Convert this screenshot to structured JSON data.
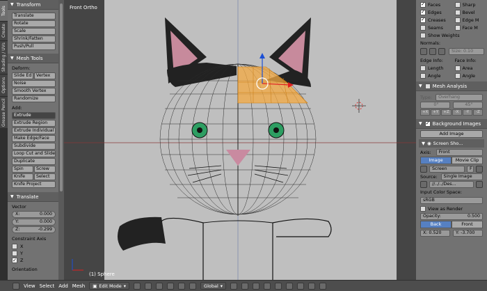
{
  "vtabs": [
    "Tools",
    "Create",
    "Shading / UVs",
    "Options",
    "Grease Pencil"
  ],
  "transform_panel": {
    "title": "Transform",
    "buttons": [
      "Translate",
      "Rotate",
      "Scale",
      "Shrink/Fatten",
      "Push/Pull"
    ]
  },
  "mesh_tools": {
    "title": "Mesh Tools",
    "deform_label": "Deform:",
    "deform_row": [
      "Slide Ed",
      "Vertex"
    ],
    "deform_buttons": [
      "Noise",
      "Smooth Vertex",
      "Randomize"
    ],
    "add_label": "Add:",
    "add_buttons": [
      "Extrude",
      "Extrude Region",
      "Extrude Individual",
      "Make Edge/Face",
      "Subdivide",
      "Loop Cut and Slide",
      "Duplicate"
    ],
    "rows": [
      [
        "Spin",
        "Screw"
      ],
      [
        "Knife",
        "Select"
      ]
    ],
    "knife_project": "Knife Project"
  },
  "translate_panel": {
    "title": "Translate",
    "vector_label": "Vector",
    "x": "X:",
    "x_val": "0.000",
    "y": "Y:",
    "y_val": "0.000",
    "z": "Z:",
    "z_val": "-0.299",
    "constraint_label": "Constraint Axis",
    "axes": [
      "X",
      "Y",
      "Z"
    ],
    "orientation_label": "Orientation"
  },
  "viewport": {
    "title": "Front Ortho",
    "object": "(1) Sphere"
  },
  "props": {
    "overlay": [
      {
        "label": "Faces",
        "on": true,
        "label2": "Sharp",
        "on2": false
      },
      {
        "label": "Edges",
        "on": true,
        "label2": "Bevel",
        "on2": false
      },
      {
        "label": "Creases",
        "on": true,
        "label2": "Edge M",
        "on2": false
      },
      {
        "label": "Seams",
        "on": false,
        "label2": "Face M",
        "on2": false
      }
    ],
    "show_weights": "Show Weights",
    "normals_label": "Normals:",
    "size_label": "Size: 0.10",
    "edge_info": "Edge Info:",
    "face_info": "Face Info:",
    "info_rows": [
      [
        "Length",
        "Area"
      ],
      [
        "Angle",
        "Angle"
      ]
    ],
    "mesh_analysis": "Mesh Analysis",
    "type_label": "Type:",
    "type_value": "Overhang",
    "angle_min": "0°",
    "angle_max": "45°",
    "axis_buttons": [
      "+X",
      "+Y",
      "+Z",
      "-X",
      "-Y",
      "-Z"
    ],
    "background_images": "Background Images",
    "add_image": "Add Image",
    "screen_shot": "Screen Sho...",
    "axis_label": "Axis:",
    "axis_value": "Front",
    "image_tab": "Image",
    "movie_tab": "Movie Clip",
    "screen_field": "Screen",
    "screen_f": "F",
    "source_label": "Source:",
    "source_value": "Single Image",
    "path_value": "//../../Des...",
    "input_color": "Input Color Space:",
    "color_space": "sRGB",
    "view_as_render": "View as Render",
    "opacity": "Opacity:",
    "opacity_val": "0.500",
    "back": "Back",
    "front": "Front",
    "x_off": "X: 0.520",
    "y_off": "Y: -3.700"
  },
  "header": {
    "menus": [
      "View",
      "Select",
      "Add",
      "Mesh"
    ],
    "mode": "Edit Mode",
    "orientation": "Global"
  },
  "colors": {
    "selection": "#f4a942",
    "eye": "#3aa866",
    "nose": "#c98aa0",
    "ear_inner": "#c98aa0"
  }
}
